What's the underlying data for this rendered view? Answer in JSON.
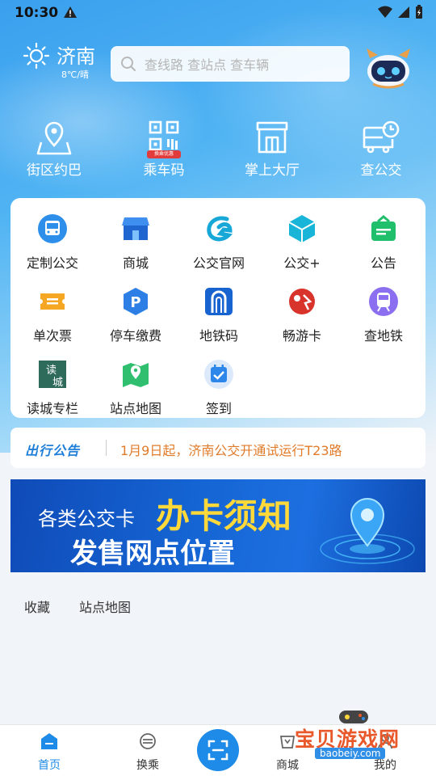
{
  "status_bar": {
    "time": "10:30"
  },
  "header": {
    "city": "济南",
    "weather": "8℃/晴",
    "search_placeholder": "查线路 查站点 查车辆"
  },
  "quick_actions": [
    {
      "label": "街区约巴",
      "icon": "map-pin-icon"
    },
    {
      "label": "乘车码",
      "icon": "qr-code-icon",
      "badge": "换乘优惠"
    },
    {
      "label": "掌上大厅",
      "icon": "hall-icon"
    },
    {
      "label": "查公交",
      "icon": "bus-clock-icon"
    }
  ],
  "services": [
    {
      "label": "定制公交",
      "icon": "custom-bus-icon"
    },
    {
      "label": "商城",
      "icon": "mall-icon"
    },
    {
      "label": "公交官网",
      "icon": "official-site-icon"
    },
    {
      "label": "公交+",
      "icon": "bus-plus-icon"
    },
    {
      "label": "公告",
      "icon": "announcement-icon"
    },
    {
      "label": "单次票",
      "icon": "single-ticket-icon"
    },
    {
      "label": "停车缴费",
      "icon": "parking-icon"
    },
    {
      "label": "地铁码",
      "icon": "metro-code-icon"
    },
    {
      "label": "畅游卡",
      "icon": "tour-card-icon"
    },
    {
      "label": "查地铁",
      "icon": "metro-icon"
    },
    {
      "label": "读城专栏",
      "icon": "read-city-icon"
    },
    {
      "label": "站点地图",
      "icon": "station-map-icon"
    },
    {
      "label": "签到",
      "icon": "check-in-icon"
    }
  ],
  "notice": {
    "tag": "出行公告",
    "message": "1月9日起，济南公交开通试运行T23路"
  },
  "banner": {
    "line1_prefix": "各类公交卡",
    "line1_highlight": "办卡须知",
    "line2": "发售网点位置"
  },
  "tabs": [
    "收藏",
    "站点地图"
  ],
  "bottom_nav": [
    {
      "label": "首页",
      "icon": "home-icon",
      "active": true
    },
    {
      "label": "换乘",
      "icon": "transfer-icon",
      "active": false
    },
    {
      "label": "商城",
      "icon": "shop-icon",
      "active": false
    },
    {
      "label": "我的",
      "icon": "profile-icon",
      "active": false
    }
  ],
  "watermark": {
    "title": "宝贝游戏网",
    "url": "baobeiy.com"
  },
  "colors": {
    "primary": "#1e8be8",
    "notice_text": "#e07b2a",
    "banner_highlight": "#ffd83a"
  }
}
